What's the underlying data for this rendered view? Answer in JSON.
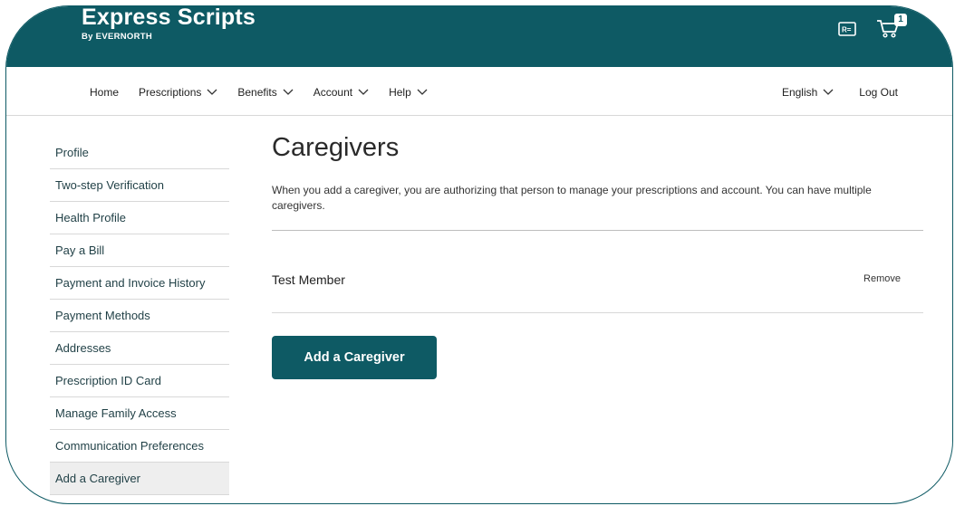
{
  "brand": {
    "name": "Express Scripts",
    "by": "By EVERNORTH"
  },
  "header_icons": {
    "id_card_icon": "id-card-icon",
    "cart_icon": "cart-icon",
    "cart_count": "1"
  },
  "nav": {
    "left": [
      {
        "label": "Home",
        "dropdown": false
      },
      {
        "label": "Prescriptions",
        "dropdown": true
      },
      {
        "label": "Benefits",
        "dropdown": true
      },
      {
        "label": "Account",
        "dropdown": true
      },
      {
        "label": "Help",
        "dropdown": true
      }
    ],
    "language": "English",
    "logout": "Log Out"
  },
  "sidebar": {
    "items": [
      {
        "label": "Profile"
      },
      {
        "label": "Two-step Verification"
      },
      {
        "label": "Health Profile"
      },
      {
        "label": "Pay a Bill"
      },
      {
        "label": "Payment and Invoice History"
      },
      {
        "label": "Payment Methods"
      },
      {
        "label": "Addresses"
      },
      {
        "label": "Prescription ID Card"
      },
      {
        "label": "Manage Family Access"
      },
      {
        "label": "Communication Preferences"
      },
      {
        "label": "Add a Caregiver",
        "active": true
      }
    ]
  },
  "main": {
    "title": "Caregivers",
    "description": "When you add a caregiver, you are authorizing that person to manage your prescriptions and account. You can have multiple caregivers.",
    "caregivers": [
      {
        "name": "Test Member",
        "remove_label": "Remove"
      }
    ],
    "add_button": "Add a Caregiver"
  },
  "colors": {
    "brand_teal": "#0e5a64"
  }
}
